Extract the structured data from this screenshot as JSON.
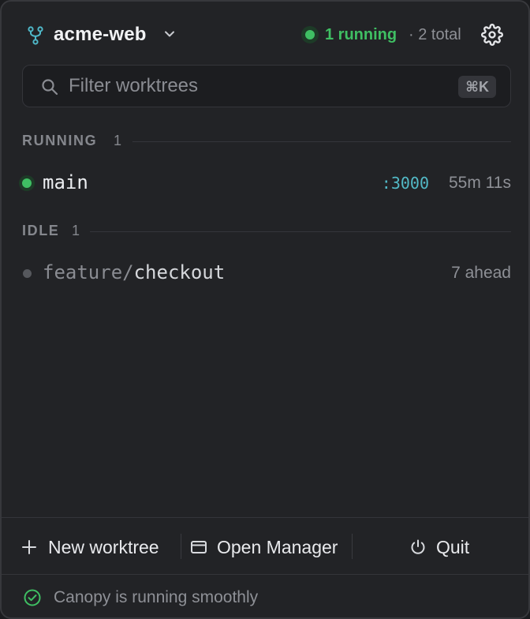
{
  "header": {
    "repo_name": "acme-web",
    "status_running": "1 running",
    "status_total": "· 2 total"
  },
  "search": {
    "placeholder": "Filter worktrees",
    "shortcut": "⌘K"
  },
  "sections": {
    "running": {
      "title": "RUNNING",
      "count": "1",
      "rows": [
        {
          "branch": "main",
          "port": ":3000",
          "uptime": "55m 11s"
        }
      ]
    },
    "idle": {
      "title": "IDLE",
      "count": "1",
      "rows": [
        {
          "branch_prefix": "feature/",
          "branch_leaf": "checkout",
          "ahead": "7 ahead"
        }
      ]
    }
  },
  "footer": {
    "new_worktree": "New worktree",
    "open_manager": "Open Manager",
    "quit": "Quit"
  },
  "statusbar": {
    "message": "Canopy is running smoothly"
  },
  "icons": {
    "repo": "git-branch-icon",
    "chevron": "chevron-down-icon",
    "settings": "gear-icon",
    "search": "search-icon",
    "new": "plus-icon",
    "manager": "window-icon",
    "quit": "power-icon",
    "ok": "check-circle-icon"
  },
  "colors": {
    "accent_green": "#3fbf63",
    "port_cyan": "#52b9c6",
    "background": "#222326"
  }
}
